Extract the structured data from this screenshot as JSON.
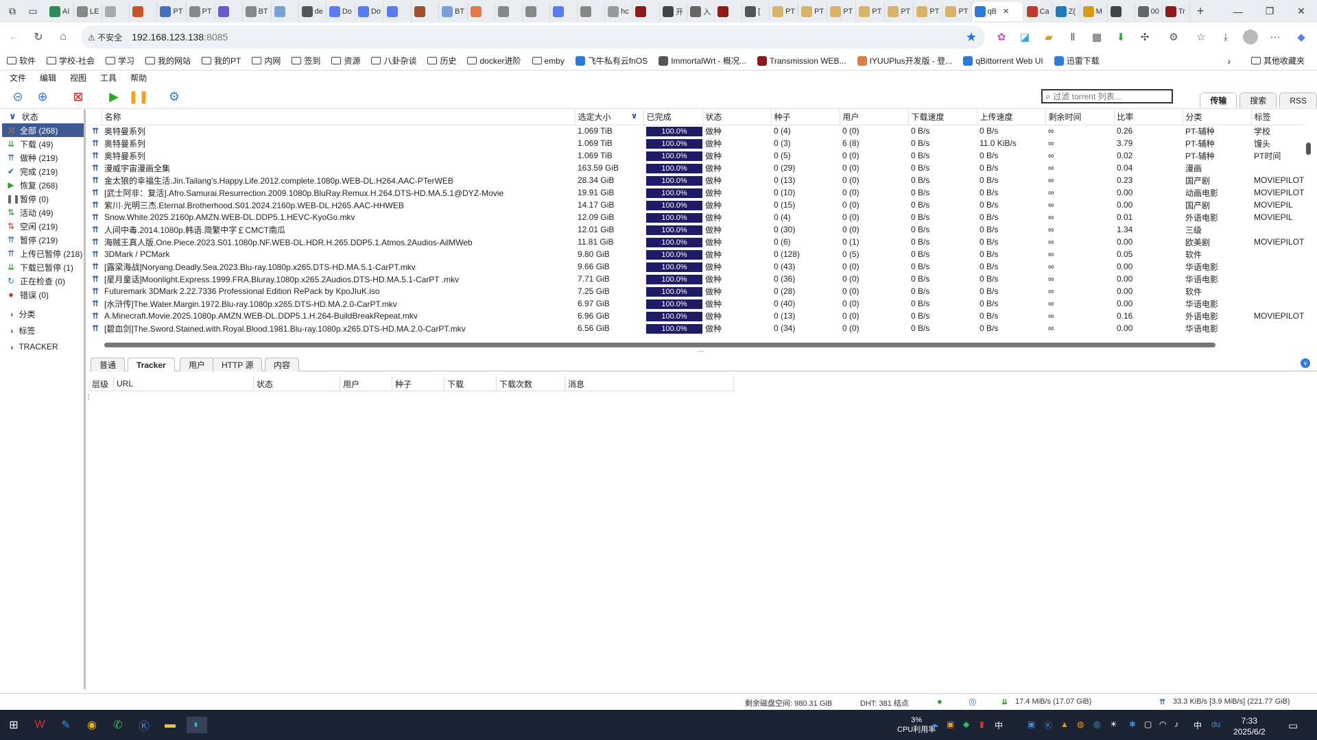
{
  "browser": {
    "tabs": [
      "AI",
      "LE",
      "",
      "",
      "PT",
      "PT",
      "",
      "BT",
      "",
      "de",
      "Do",
      "Do",
      "",
      "",
      "BT",
      "",
      "",
      "",
      "",
      "",
      "hc",
      "",
      "开",
      "入",
      "",
      "[",
      "PT",
      "PT",
      "PT",
      "PT",
      "PT",
      "PT",
      "PT",
      "qB",
      "Ca",
      "Z(",
      "M",
      "",
      "00",
      "Tr"
    ],
    "active_tab_label": "qB",
    "url_warning": "不安全",
    "url_host": "192.168.123.138",
    "url_port": ":8085",
    "bookmarks": [
      "软件",
      "学校-社会",
      "学习",
      "我的网站",
      "我的PT",
      "内网",
      "签到",
      "资源",
      "八卦杂谈",
      "历史",
      "docker进阶",
      "emby",
      "飞牛私有云fnOS",
      "ImmortalWrt - 概况...",
      "Transmission WEB...",
      "IYUUPlus开发版 - 登...",
      "qBittorrent Web UI",
      "迅雷下载"
    ],
    "bookmarks_other": "其他收藏夹"
  },
  "menu": [
    "文件",
    "编辑",
    "视图",
    "工具",
    "帮助"
  ],
  "toolbar": {
    "filter_placeholder": "过滤 torrent 列表...",
    "right_tabs": [
      "传输",
      "搜索",
      "RSS"
    ]
  },
  "sidebar": {
    "status_header": "状态",
    "items": [
      {
        "label": "全部 (268)",
        "icon": "shuffle-icon",
        "color": "#d9541e"
      },
      {
        "label": "下载 (49)",
        "icon": "download-icon",
        "color": "#2a8a2a"
      },
      {
        "label": "做种 (219)",
        "icon": "upload-icon",
        "color": "#2e5aa8"
      },
      {
        "label": "完成 (219)",
        "icon": "check-icon",
        "color": "#1e5aa8"
      },
      {
        "label": "恢复 (268)",
        "icon": "play-icon",
        "color": "#2aa52a"
      },
      {
        "label": "暂停 (0)",
        "icon": "pause-icon",
        "color": "#666666"
      },
      {
        "label": "活动 (49)",
        "icon": "active-icon",
        "color": "#2a8a2a"
      },
      {
        "label": "空闲 (219)",
        "icon": "idle-icon",
        "color": "#c0392b"
      },
      {
        "label": "暂停 (219)",
        "icon": "stalled-icon",
        "color": "#2e5aa8"
      },
      {
        "label": "上传已暂停 (218)",
        "icon": "stalled-up-icon",
        "color": "#2e5aa8"
      },
      {
        "label": "下载已暂停 (1)",
        "icon": "stalled-down-icon",
        "color": "#2a8a2a"
      },
      {
        "label": "正在检查 (0)",
        "icon": "checking-icon",
        "color": "#1e7aa8"
      },
      {
        "label": "错误 (0)",
        "icon": "error-icon",
        "color": "#d21d1d"
      }
    ],
    "groups": [
      "分类",
      "标签",
      "TRACKER"
    ]
  },
  "table": {
    "columns": [
      "名称",
      "选定大小",
      "已完成",
      "状态",
      "种子",
      "用户",
      "下载速度",
      "上传速度",
      "剩余时间",
      "比率",
      "分类",
      "标签"
    ],
    "rows": [
      [
        "奥特曼系列",
        "1.069 TiB",
        "100.0%",
        "做种",
        "0 (4)",
        "0 (0)",
        "0 B/s",
        "0 B/s",
        "∞",
        "0.26",
        "PT-辅种",
        "学校"
      ],
      [
        "奥特曼系列",
        "1.069 TiB",
        "100.0%",
        "做种",
        "0 (3)",
        "6 (8)",
        "0 B/s",
        "11.0 KiB/s",
        "∞",
        "3.79",
        "PT-辅种",
        "馒头"
      ],
      [
        "奥特曼系列",
        "1.069 TiB",
        "100.0%",
        "做种",
        "0 (5)",
        "0 (0)",
        "0 B/s",
        "0 B/s",
        "∞",
        "0.02",
        "PT-辅种",
        "PT时间"
      ],
      [
        "漫威宇宙漫画全集",
        "163.59 GiB",
        "100.0%",
        "做种",
        "0 (29)",
        "0 (0)",
        "0 B/s",
        "0 B/s",
        "∞",
        "0.04",
        "漫画",
        ""
      ],
      [
        "金太狼的幸福生活.Jin.Tailang's.Happy.Life.2012.complete.1080p.WEB-DL.H264.AAC-PTerWEB",
        "28.34 GiB",
        "100.0%",
        "做种",
        "0 (13)",
        "0 (0)",
        "0 B/s",
        "0 B/s",
        "∞",
        "0.23",
        "国产剧",
        "MOVIEPILOT"
      ],
      [
        "[武士阿非：复活].Afro.Samurai.Resurrection.2009.1080p.BluRay.Remux.H.264.DTS-HD.MA.5.1@DYZ-Movie",
        "19.91 GiB",
        "100.0%",
        "做种",
        "0 (10)",
        "0 (0)",
        "0 B/s",
        "0 B/s",
        "∞",
        "0.00",
        "动画电影",
        "MOVIEPILOT"
      ],
      [
        "紫川·光明三杰.Eternal.Brotherhood.S01.2024.2160p.WEB-DL.H265.AAC-HHWEB",
        "14.17 GiB",
        "100.0%",
        "做种",
        "0 (15)",
        "0 (0)",
        "0 B/s",
        "0 B/s",
        "∞",
        "0.00",
        "国产剧",
        "MOVIEPIL"
      ],
      [
        "Snow.White.2025.2160p.AMZN.WEB-DL.DDP5.1.HEVC-KyoGo.mkv",
        "12.09 GiB",
        "100.0%",
        "做种",
        "0 (4)",
        "0 (0)",
        "0 B/s",
        "0 B/s",
        "∞",
        "0.01",
        "外语电影",
        "MOVIEPIL"
      ],
      [
        "人间中毒.2014.1080p.韩语.简繁中字￡CMCT南瓜",
        "12.01 GiB",
        "100.0%",
        "做种",
        "0 (30)",
        "0 (0)",
        "0 B/s",
        "0 B/s",
        "∞",
        "1.34",
        "三级",
        ""
      ],
      [
        "海贼王真人版.One.Piece.2023.S01.1080p.NF.WEB-DL.HDR.H.265.DDP5.1.Atmos.2Audios-AilMWeb",
        "11.81 GiB",
        "100.0%",
        "做种",
        "0 (6)",
        "0 (1)",
        "0 B/s",
        "0 B/s",
        "∞",
        "0.00",
        "欧美剧",
        "MOVIEPILOT"
      ],
      [
        "3DMark / PCMark",
        "9.80 GiB",
        "100.0%",
        "做种",
        "0 (128)",
        "0 (5)",
        "0 B/s",
        "0 B/s",
        "∞",
        "0.05",
        "软件",
        ""
      ],
      [
        "[露梁海战]Noryang.Deadly.Sea.2023.Blu-ray.1080p.x265.DTS-HD.MA.5.1-CarPT.mkv",
        "9.66 GiB",
        "100.0%",
        "做种",
        "0 (43)",
        "0 (0)",
        "0 B/s",
        "0 B/s",
        "∞",
        "0.00",
        "华语电影",
        ""
      ],
      [
        "[星月童话]Moonlight.Express.1999.FRA.Bluray.1080p.x265.2Audios.DTS-HD.MA.5.1-CarPT .mkv",
        "7.71 GiB",
        "100.0%",
        "做种",
        "0 (36)",
        "0 (0)",
        "0 B/s",
        "0 B/s",
        "∞",
        "0.00",
        "华语电影",
        ""
      ],
      [
        "Futuremark 3DMark 2.22.7336 Professional Edition RePack by KpoJIuK.iso",
        "7.25 GiB",
        "100.0%",
        "做种",
        "0 (28)",
        "0 (0)",
        "0 B/s",
        "0 B/s",
        "∞",
        "0.00",
        "软件",
        ""
      ],
      [
        "[水浒传]The.Water.Margin.1972.Blu-ray.1080p.x265.DTS-HD.MA.2.0-CarPT.mkv",
        "6.97 GiB",
        "100.0%",
        "做种",
        "0 (40)",
        "0 (0)",
        "0 B/s",
        "0 B/s",
        "∞",
        "0.00",
        "华语电影",
        ""
      ],
      [
        "A.Minecraft.Movie.2025.1080p.AMZN.WEB-DL.DDP5.1.H.264-BuildBreakRepeat.mkv",
        "6.96 GiB",
        "100.0%",
        "做种",
        "0 (13)",
        "0 (0)",
        "0 B/s",
        "0 B/s",
        "∞",
        "0.16",
        "外语电影",
        "MOVIEPILOT"
      ],
      [
        "[碧血剑]The.Sword.Stained.with.Royal.Blood.1981.Blu-ray.1080p.x265.DTS-HD.MA.2.0-CarPT.mkv",
        "6.56 GiB",
        "100.0%",
        "做种",
        "0 (34)",
        "0 (0)",
        "0 B/s",
        "0 B/s",
        "∞",
        "0.00",
        "华语电影",
        ""
      ]
    ]
  },
  "props": {
    "tabs": [
      "普通",
      "Tracker",
      "用户",
      "HTTP 源",
      "内容"
    ],
    "active": "Tracker",
    "tracker_columns": [
      "层级",
      "URL",
      "状态",
      "用户",
      "种子",
      "下载",
      "下载次数",
      "消息"
    ]
  },
  "status": {
    "free_space": "剩余磁盘空间: 980.31 GiB",
    "dht": "DHT: 381 结点",
    "download": "17.4 MiB/s (17.07 GiB)",
    "upload": "33.3 KiB/s [3.9 MiB/s] (221.77 GiB)"
  },
  "taskbar": {
    "cpu_percent": "3%",
    "cpu_label": "CPU利用率",
    "ime": "中",
    "time": "7:33",
    "date": "2025/6/2"
  }
}
